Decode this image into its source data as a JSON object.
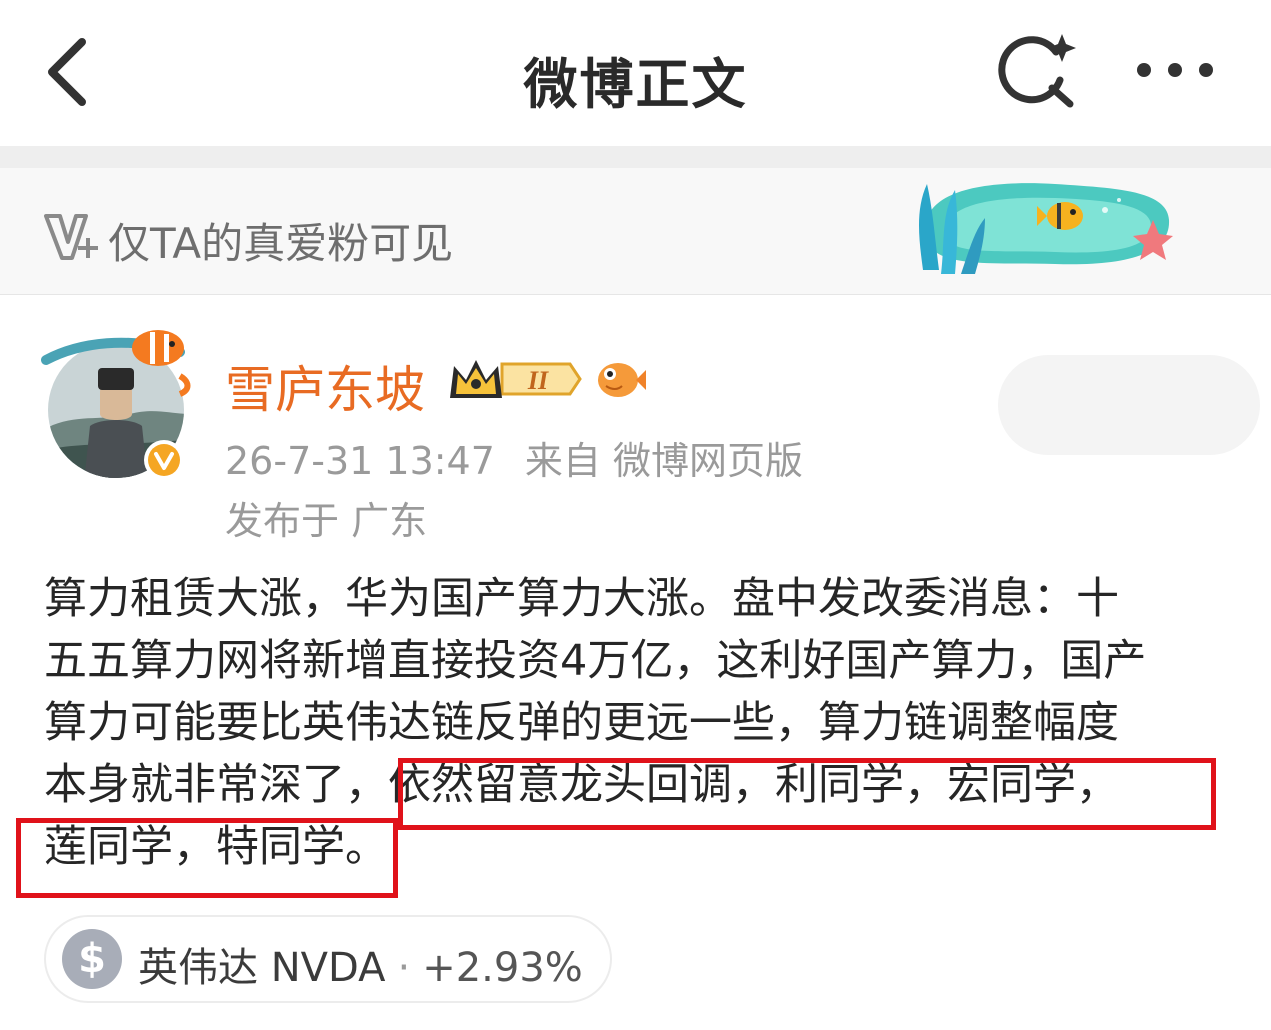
{
  "header": {
    "title": "微博正文",
    "back_icon": "chevron-left-icon",
    "search_icon": "search-sparkle-icon",
    "more_icon": "more-dots-icon"
  },
  "fans_banner": {
    "text": "仅TA的真爱粉可见",
    "icon": "vplus-icon"
  },
  "post": {
    "author": {
      "name": "雪庐东坡",
      "rank_badge": "II",
      "name_color": "#e86b23"
    },
    "time": "26-7-31 13:47",
    "source": "来自 微博网页版",
    "location": "发布于 广东",
    "text_lines": [
      "算力租赁大涨，华为国产算力大涨。盘中发改委消息：十",
      "五五算力网将新增直接投资4万亿，这利好国产算力，国产",
      "算力可能要比英伟达链反弹的更远一些，算力链调整幅度",
      "本身就非常深了，依然留意龙头回调，利同学，宏同学，",
      "莲同学，特同学。"
    ],
    "highlight_color": "#e0121a"
  },
  "stock": {
    "icon": "dollar-icon",
    "name": "英伟达 NVDA",
    "separator": "·",
    "change": "+2.93%"
  }
}
